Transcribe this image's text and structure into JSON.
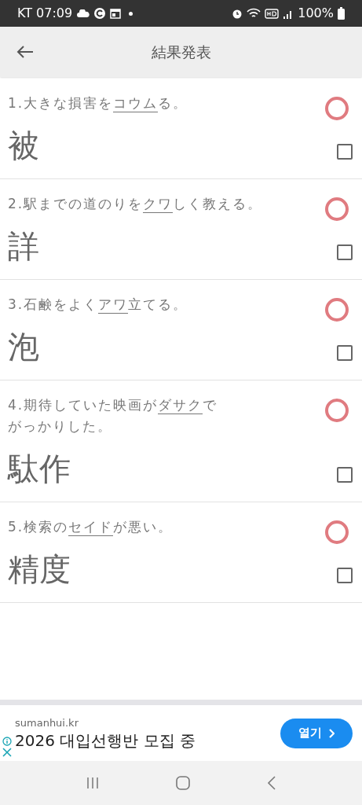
{
  "status_bar": {
    "carrier_time": "KT 07:09",
    "battery": "100%"
  },
  "header": {
    "title": "結果発表"
  },
  "items": [
    {
      "lines": [
        [
          {
            "text": "1.大きな損害を",
            "underlined": false
          },
          {
            "text": "コウム",
            "underlined": true
          },
          {
            "text": "る。",
            "underlined": false
          }
        ]
      ],
      "answer": "被",
      "correct": true,
      "checked": false
    },
    {
      "lines": [
        [
          {
            "text": "2.駅までの道のりを",
            "underlined": false
          },
          {
            "text": "クワ",
            "underlined": true
          },
          {
            "text": "しく教える。",
            "underlined": false
          }
        ]
      ],
      "answer": "詳",
      "correct": true,
      "checked": false
    },
    {
      "lines": [
        [
          {
            "text": "3.石鹸をよく",
            "underlined": false
          },
          {
            "text": "アワ",
            "underlined": true
          },
          {
            "text": "立てる。",
            "underlined": false
          }
        ]
      ],
      "answer": "泡",
      "correct": true,
      "checked": false
    },
    {
      "lines": [
        [
          {
            "text": "4.期待していた映画が",
            "underlined": false
          },
          {
            "text": "ダサク",
            "underlined": true
          },
          {
            "text": "で",
            "underlined": false
          }
        ],
        [
          {
            "text": "がっかりした。",
            "underlined": false
          }
        ]
      ],
      "answer": "駄作",
      "correct": true,
      "checked": false
    },
    {
      "lines": [
        [
          {
            "text": "5.検索の",
            "underlined": false
          },
          {
            "text": "セイド",
            "underlined": true
          },
          {
            "text": "が悪い。",
            "underlined": false
          }
        ]
      ],
      "answer": "精度",
      "correct": true,
      "checked": false
    }
  ],
  "ad": {
    "domain": "sumanhui.kr",
    "headline": "2026 대입선행반 모집 중",
    "button": "열기"
  }
}
